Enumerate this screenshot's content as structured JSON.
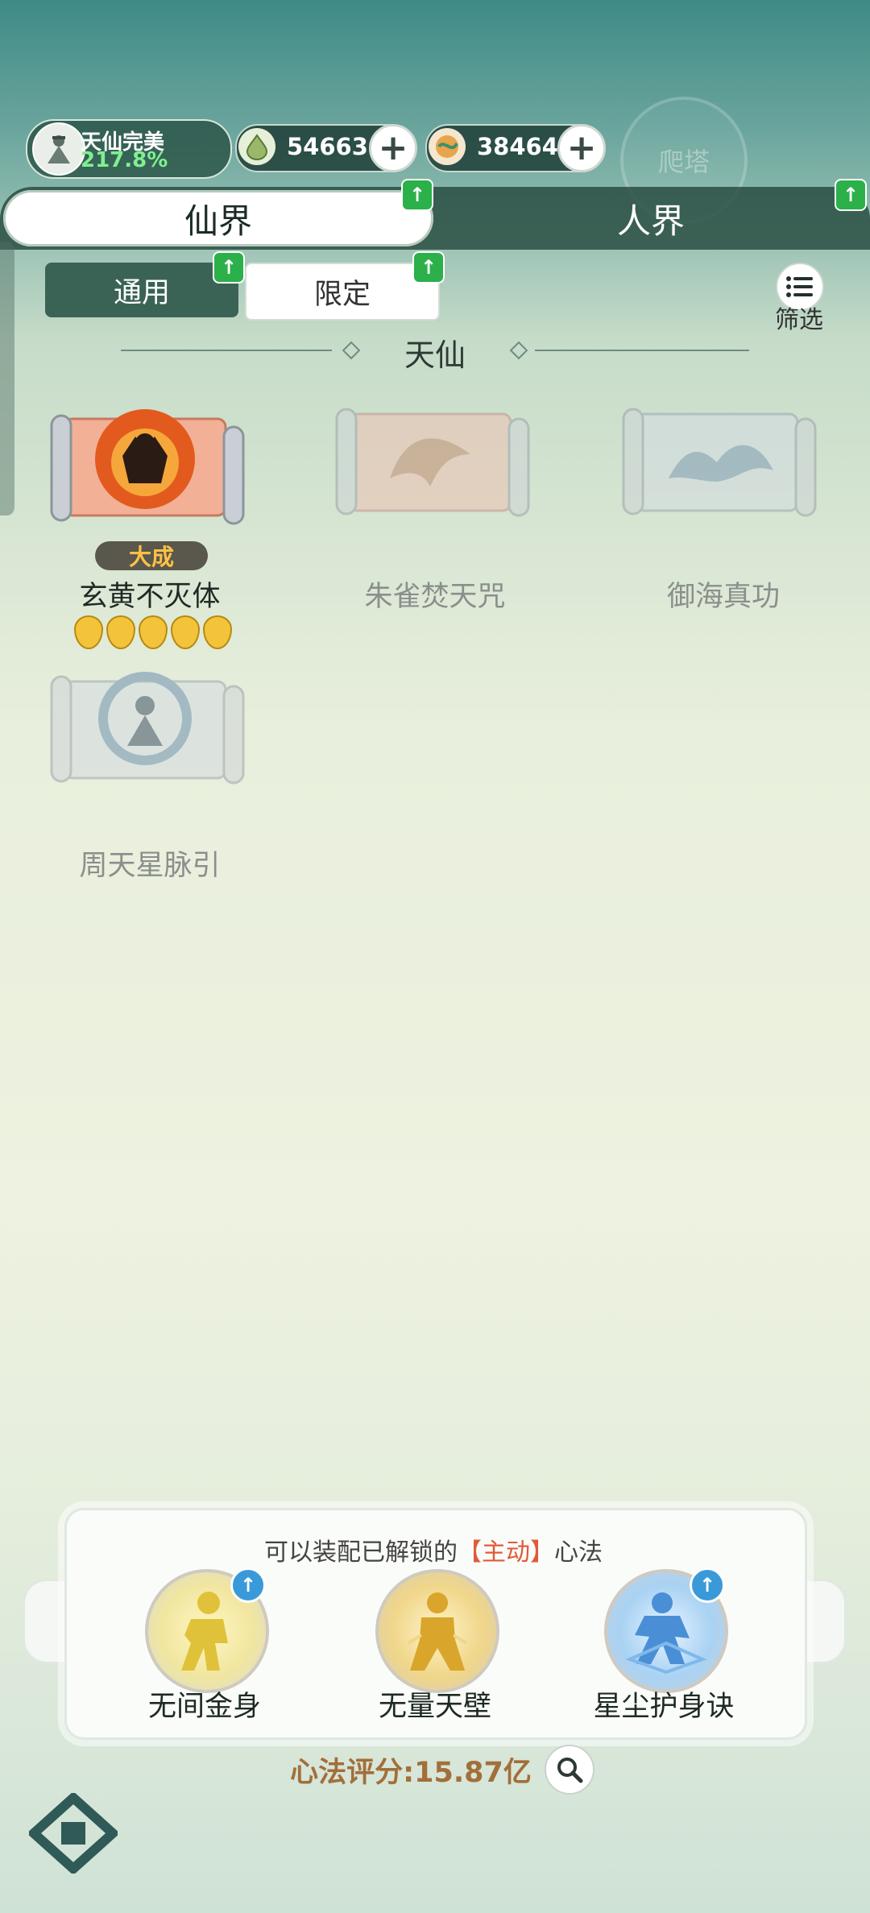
{
  "header": {
    "realm_name": "天仙完美",
    "realm_percent": "217.8%",
    "currency1_value": "54663",
    "currency2_value": "38464",
    "tower_label": "爬塔"
  },
  "tabs": {
    "active": "仙界",
    "inactive": "人界"
  },
  "subtabs": {
    "general": "通用",
    "limited": "限定",
    "filter": "筛选"
  },
  "section": {
    "title": "天仙"
  },
  "skills": [
    {
      "name": "玄黄不灭体",
      "rank": "大成",
      "unlocked": true,
      "stars": 5
    },
    {
      "name": "朱雀焚天咒",
      "unlocked": false
    },
    {
      "name": "御海真功",
      "unlocked": false
    },
    {
      "name": "周天星脉引",
      "unlocked": false
    }
  ],
  "equip_panel": {
    "hint_prefix": "可以装配已解锁的",
    "hint_highlight": "【主动】",
    "hint_suffix": "心法",
    "slots": [
      {
        "name": "无间金身"
      },
      {
        "name": "无量天壁"
      },
      {
        "name": "星尘护身诀"
      }
    ]
  },
  "score": "心法评分:15.87亿",
  "colors": {
    "accent_green": "#2bb04a",
    "tab_dark": "#26493e",
    "gold": "#ffc145",
    "score_brown": "#a26f3a",
    "highlight_red": "#e05a3a"
  }
}
